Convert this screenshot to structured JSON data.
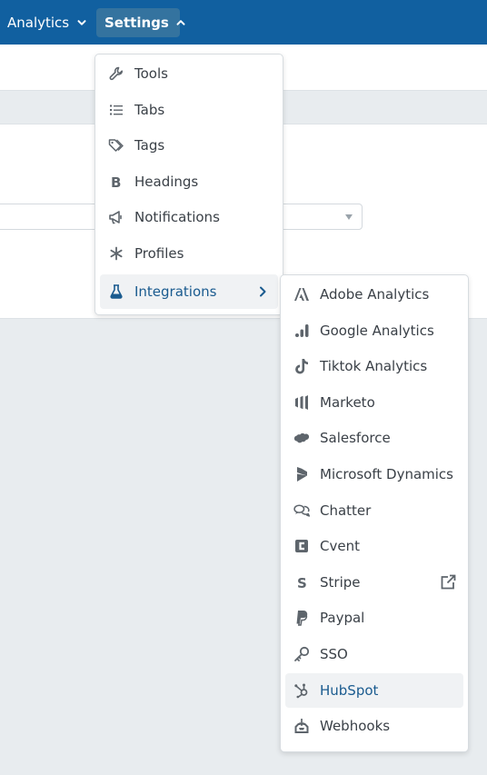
{
  "topbar": {
    "analytics_label": "Analytics",
    "settings_label": "Settings"
  },
  "settings_menu": {
    "items": [
      {
        "label": "Tools",
        "icon": "wrench-icon"
      },
      {
        "label": "Tabs",
        "icon": "list-icon"
      },
      {
        "label": "Tags",
        "icon": "tags-icon"
      },
      {
        "label": "Headings",
        "icon": "bold-icon"
      },
      {
        "label": "Notifications",
        "icon": "megaphone-icon"
      },
      {
        "label": "Profiles",
        "icon": "asterisk-icon"
      },
      {
        "label": "Integrations",
        "icon": "flask-icon"
      }
    ]
  },
  "integrations_menu": {
    "items": [
      {
        "label": "Adobe Analytics",
        "icon": "adobe-icon"
      },
      {
        "label": "Google Analytics",
        "icon": "google-analytics-icon"
      },
      {
        "label": "Tiktok Analytics",
        "icon": "tiktok-icon"
      },
      {
        "label": "Marketo",
        "icon": "marketo-icon"
      },
      {
        "label": "Salesforce",
        "icon": "salesforce-icon"
      },
      {
        "label": "Microsoft Dynamics",
        "icon": "microsoft-dynamics-icon"
      },
      {
        "label": "Chatter",
        "icon": "chatter-icon"
      },
      {
        "label": "Cvent",
        "icon": "cvent-icon"
      },
      {
        "label": "Stripe",
        "icon": "stripe-icon"
      },
      {
        "label": "Paypal",
        "icon": "paypal-icon"
      },
      {
        "label": "SSO",
        "icon": "key-icon"
      },
      {
        "label": "HubSpot",
        "icon": "hubspot-icon"
      },
      {
        "label": "Webhooks",
        "icon": "webhooks-icon"
      }
    ]
  },
  "colors": {
    "topbar": "#1160a0",
    "active_text": "#1a5b8f",
    "menu_text": "#3a4047",
    "icon": "#5e656c"
  }
}
